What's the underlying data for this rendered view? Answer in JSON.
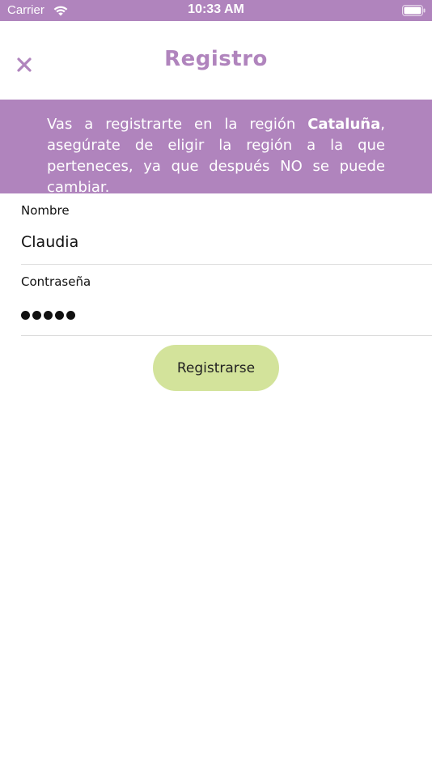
{
  "status_bar": {
    "carrier": "Carrier",
    "time": "10:33 AM",
    "wifi_icon": "wifi-icon",
    "battery_icon": "battery-icon"
  },
  "header": {
    "title": "Registro",
    "close_icon": "close-icon"
  },
  "banner": {
    "text_before": "Vas a registrarte en la región ",
    "region": "Cataluña",
    "text_after": ", asegúrate de eligir la región a la que perteneces, ya que después NO se puede cambiar."
  },
  "form": {
    "name_label": "Nombre",
    "name_value": "Claudia",
    "password_label": "Contraseña",
    "password_value": "•••••"
  },
  "actions": {
    "register_label": "Registrarse"
  },
  "colors": {
    "brand_purple": "#b084bd",
    "button_green": "#d3e39b"
  }
}
